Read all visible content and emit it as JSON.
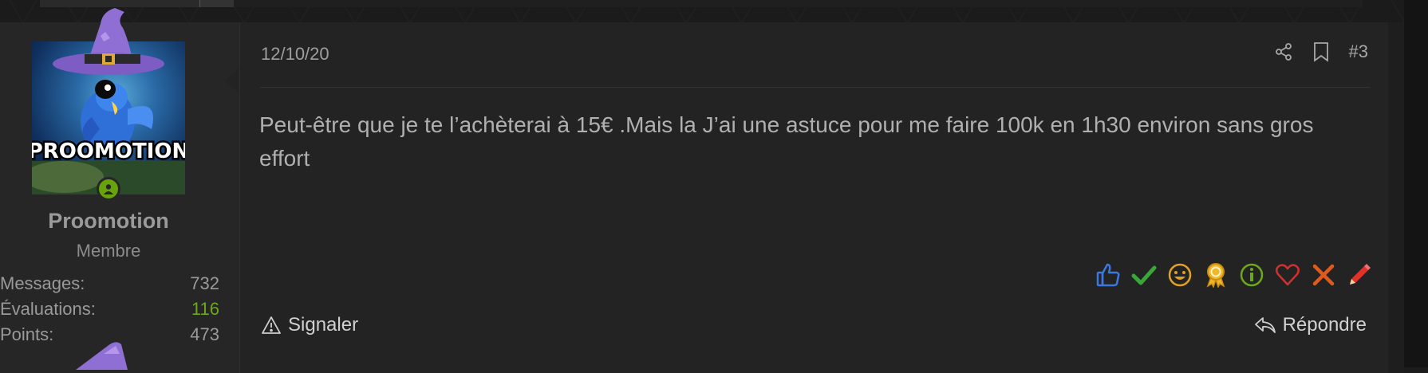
{
  "user": {
    "name": "Proomotion",
    "title": "Membre",
    "avatar_text": "PROOMOTION",
    "stats": [
      {
        "label": "Messages:",
        "value": "732"
      },
      {
        "label": "Évaluations:",
        "value": "116"
      },
      {
        "label": "Points:",
        "value": "473"
      }
    ]
  },
  "post": {
    "date": "12/10/20",
    "number": "#3",
    "text": "Peut-être que je te l’achèterai à 15€ .Mais la J’ai une astuce pour me faire 100k en 1h30 environ sans gros effort",
    "report_label": "Signaler",
    "reply_label": "Répondre"
  },
  "colors": {
    "accent_green": "#6da81a",
    "online": "#66a30c"
  },
  "reactions": [
    "thumbs-up-icon",
    "checkmark-icon",
    "smile-icon",
    "award-icon",
    "info-icon",
    "heart-icon",
    "cross-icon",
    "pencil-icon"
  ]
}
